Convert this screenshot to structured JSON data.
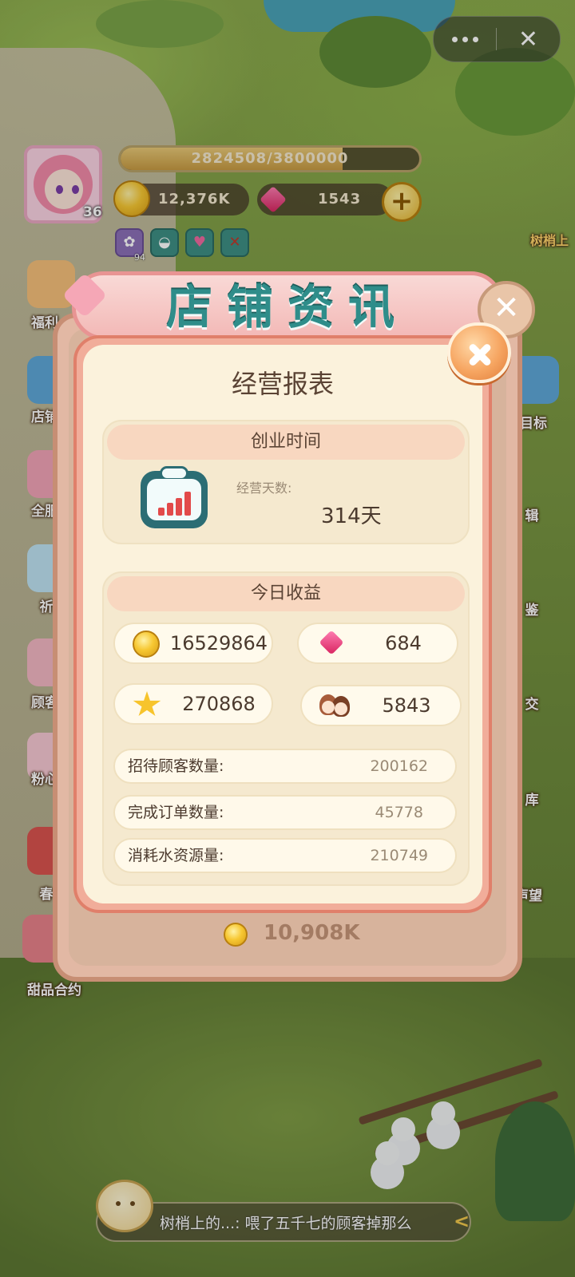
{
  "hud": {
    "exp_text": "2824508/3800000",
    "exp_progress": 0.743,
    "level": "36",
    "coins": "12,376K",
    "gems": "1543",
    "plus_label": "+",
    "buff_badge": "94"
  },
  "capsule": {
    "close_label": "✕"
  },
  "side_menu": {
    "left": [
      "福利",
      "店铺",
      "全服",
      "祈",
      "顾客",
      "粉心",
      "春",
      "甜品合约"
    ],
    "right": [
      "目标",
      "辑",
      "鉴",
      "交",
      "库",
      "声望"
    ],
    "top_right_label": "树梢上"
  },
  "outer_dialog": {
    "title": "店铺资讯",
    "coin_text": "10,908K",
    "close_label": "✕"
  },
  "report": {
    "title": "经营报表",
    "startup_section": {
      "header": "创业时间",
      "days_label": "经营天数:",
      "days_value": "314天"
    },
    "income_section": {
      "header": "今日收益",
      "coins": "16529864",
      "gems": "684",
      "stars": "270868",
      "customers": "5843"
    },
    "stats": [
      {
        "label": "招待顾客数量:",
        "value": "200162"
      },
      {
        "label": "完成订单数量:",
        "value": "45778"
      },
      {
        "label": "消耗水资源量:",
        "value": "210749"
      }
    ]
  },
  "chat": {
    "text": "树梢上的...:  喂了五千七的顾客掉那么",
    "arrow": "<"
  },
  "colors": {
    "panel_border": "#e07f6a",
    "panel_bg": "#fbf2dc",
    "title_teal": "#2f8d8a",
    "close_orange": "#f6a561"
  }
}
